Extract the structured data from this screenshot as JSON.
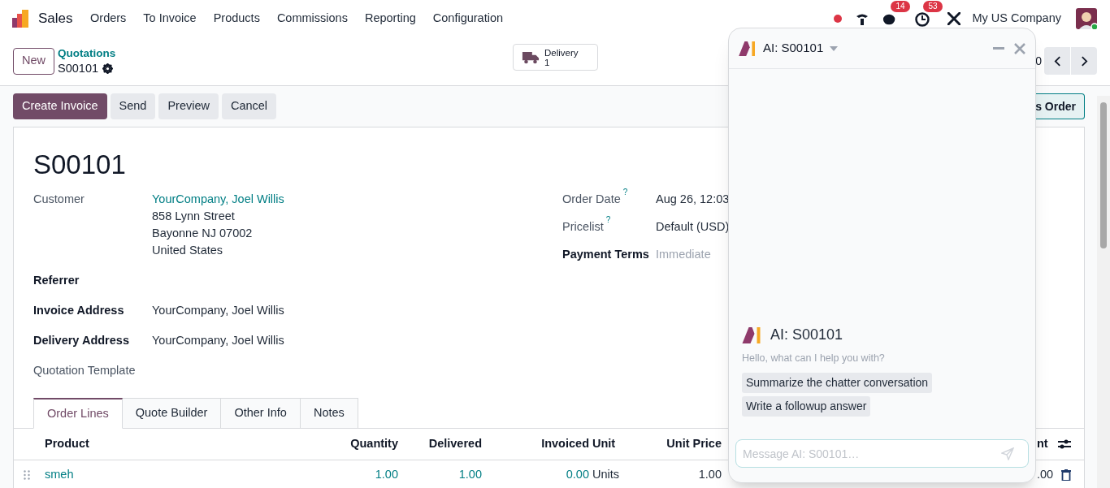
{
  "app": {
    "name": "Sales"
  },
  "menu": [
    {
      "label": "Orders"
    },
    {
      "label": "To Invoice"
    },
    {
      "label": "Products"
    },
    {
      "label": "Commissions"
    },
    {
      "label": "Reporting"
    },
    {
      "label": "Configuration"
    }
  ],
  "systray": {
    "activity_badge": "14",
    "clock_badge": "53",
    "company": "My US Company"
  },
  "breadcrumb": {
    "new_button": "New",
    "parent": "Quotations",
    "current": "S00101"
  },
  "smart_button": {
    "label": "Delivery",
    "count": "1"
  },
  "pager": {
    "value": "0"
  },
  "actions": [
    {
      "label": "Create Invoice",
      "primary": true
    },
    {
      "label": "Send",
      "primary": false
    },
    {
      "label": "Preview",
      "primary": false
    },
    {
      "label": "Cancel",
      "primary": false
    }
  ],
  "right_action": {
    "label": "s Order"
  },
  "form": {
    "title": "S00101",
    "left_fields": [
      {
        "label": "Customer",
        "strong": false,
        "link": "YourCompany, Joel Willis",
        "lines": [
          "858 Lynn Street",
          "Bayonne NJ 07002",
          "United States"
        ]
      },
      {
        "label": "Referrer",
        "strong": true
      },
      {
        "label": "Invoice Address",
        "strong": true,
        "value": "YourCompany, Joel Willis"
      },
      {
        "label": "Delivery Address",
        "strong": true,
        "value": "YourCompany, Joel Willis"
      },
      {
        "label": "Quotation Template",
        "strong": false
      }
    ],
    "right_fields": [
      {
        "label": "Order Date",
        "strong": false,
        "help": "?",
        "value": "Aug 26, 12:03"
      },
      {
        "label": "Pricelist",
        "strong": false,
        "help": "?",
        "value": "Default (USD)"
      },
      {
        "label": "Payment Terms",
        "strong": true,
        "placeholder": "Immediate"
      }
    ]
  },
  "tabs": [
    {
      "label": "Order Lines",
      "selected": true
    },
    {
      "label": "Quote Builder",
      "selected": false
    },
    {
      "label": "Other Info",
      "selected": false
    },
    {
      "label": "Notes",
      "selected": false
    }
  ],
  "table": {
    "columns": [
      {
        "label": "Product"
      },
      {
        "label": "Quantity"
      },
      {
        "label": "Delivered"
      },
      {
        "label": "Invoiced"
      },
      {
        "label": "Unit"
      },
      {
        "label": "Unit Price"
      },
      {
        "label": "nt"
      }
    ],
    "rows": [
      {
        "cells": [
          {
            "text": "smeh",
            "link": true
          },
          {
            "text": "1.00",
            "link": true
          },
          {
            "text": "1.00",
            "link": true
          },
          {
            "text": "0.00",
            "link": true
          },
          {
            "text": "Units",
            "link": false
          },
          {
            "text": "1.00",
            "link": false
          },
          {
            "text": ".00",
            "link": false
          }
        ]
      }
    ]
  },
  "ai_panel": {
    "title": "AI: S00101",
    "heading": "AI: S00101",
    "greeting": "Hello, what can I help you with?",
    "suggestions": [
      "Summarize the chatter conversation",
      "Write a followup answer"
    ],
    "placeholder": "Message AI: S00101…"
  }
}
